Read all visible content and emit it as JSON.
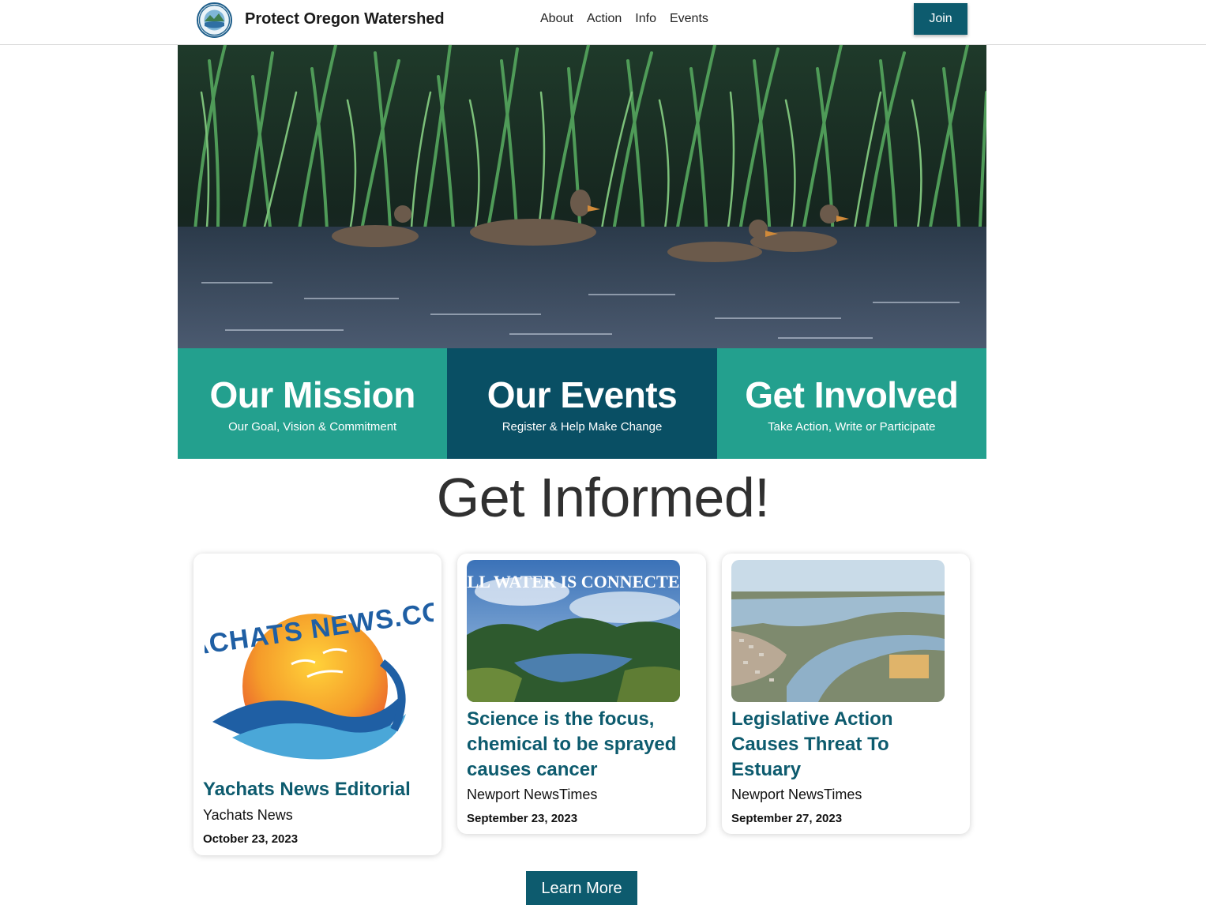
{
  "header": {
    "brand": "Protect Oregon Watershed",
    "nav": [
      "About",
      "Action",
      "Info",
      "Events"
    ],
    "join_label": "Join"
  },
  "tiles": [
    {
      "title": "Our Mission",
      "subtitle": "Our Goal, Vision & Commitment"
    },
    {
      "title": "Our Events",
      "subtitle": "Register & Help Make Change"
    },
    {
      "title": "Get Involved",
      "subtitle": "Take Action, Write or Participate"
    }
  ],
  "section_heading": "Get Informed!",
  "cards": [
    {
      "title": "Yachats News Editorial",
      "source": "Yachats News",
      "date": "October 23, 2023",
      "logo_text": "YACHATS NEWS.COM"
    },
    {
      "title": "Science is the focus, chemical to be sprayed causes cancer",
      "source": "Newport NewsTimes",
      "date": "September 23, 2023",
      "image_text": "ALL WATER IS CONNECTED"
    },
    {
      "title": "Legislative Action Causes Threat To Estuary",
      "source": "Newport NewsTimes",
      "date": "September 27, 2023"
    }
  ],
  "learn_more_label": "Learn More",
  "colors": {
    "teal": "#23a08e",
    "dark_teal": "#094f64",
    "button": "#0d5b6e"
  }
}
